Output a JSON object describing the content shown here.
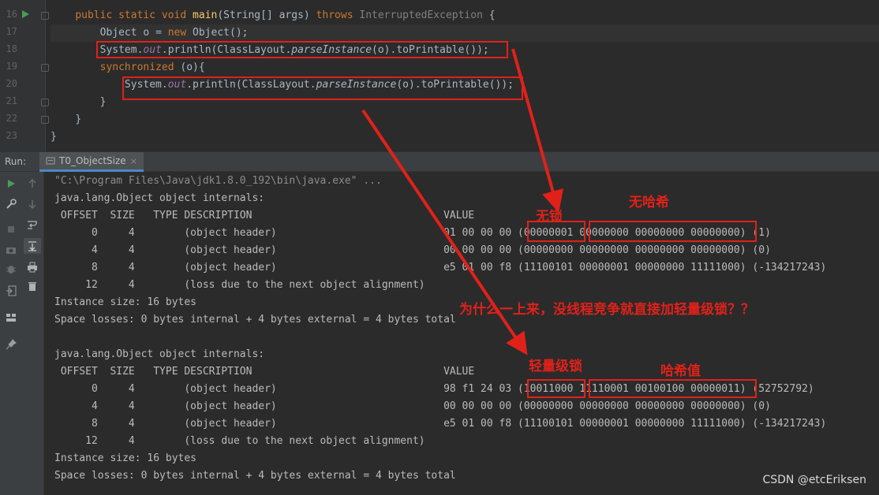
{
  "editor": {
    "line_numbers": [
      "16",
      "17",
      "18",
      "19",
      "20",
      "21",
      "22",
      "23"
    ],
    "lines": [
      {
        "indent": "    ",
        "parts": [
          [
            "kw",
            "public static void "
          ],
          [
            "fn",
            "main"
          ],
          [
            "id",
            "(String[] args) "
          ],
          [
            "kw",
            "throws "
          ],
          [
            "gray",
            "InterruptedException"
          ],
          [
            "id",
            " {"
          ]
        ]
      },
      {
        "indent": "        ",
        "parts": [
          [
            "id",
            "Object o = "
          ],
          [
            "kw",
            "new "
          ],
          [
            "id",
            "Object();"
          ]
        ]
      },
      {
        "indent": "        ",
        "parts": [
          [
            "id",
            "System."
          ],
          [
            "fld",
            "out"
          ],
          [
            "id",
            ".println(ClassLayout."
          ],
          [
            "mth",
            "parseInstance"
          ],
          [
            "id",
            "(o).toPrintable());"
          ]
        ]
      },
      {
        "indent": "        ",
        "parts": [
          [
            "kw",
            "synchronized "
          ],
          [
            "id",
            "(o){"
          ]
        ]
      },
      {
        "indent": "            ",
        "parts": [
          [
            "id",
            "System."
          ],
          [
            "fld",
            "out"
          ],
          [
            "id",
            ".println(ClassLayout."
          ],
          [
            "mth",
            "parseInstance"
          ],
          [
            "id",
            "(o).toPrintable());"
          ]
        ]
      },
      {
        "indent": "        ",
        "parts": [
          [
            "id",
            "}"
          ]
        ]
      },
      {
        "indent": "    ",
        "parts": [
          [
            "id",
            "}"
          ]
        ]
      },
      {
        "indent": "",
        "parts": [
          [
            "id",
            "}"
          ]
        ]
      }
    ]
  },
  "run": {
    "label": "Run:",
    "tab": "T0_ObjectSize",
    "close": "×"
  },
  "console": {
    "command": "\"C:\\Program Files\\Java\\jdk1.8.0_192\\bin\\java.exe\" ...",
    "lines": [
      "java.lang.Object object internals:",
      " OFFSET  SIZE   TYPE DESCRIPTION                               VALUE",
      "      0     4        (object header)                           01 00 00 00 (00000001 00000000 00000000 00000000) (1)",
      "      4     4        (object header)                           00 00 00 00 (00000000 00000000 00000000 00000000) (0)",
      "      8     4        (object header)                           e5 01 00 f8 (11100101 00000001 00000000 11111000) (-134217243)",
      "     12     4        (loss due to the next object alignment)",
      "Instance size: 16 bytes",
      "Space losses: 0 bytes internal + 4 bytes external = 4 bytes total",
      "",
      "java.lang.Object object internals:",
      " OFFSET  SIZE   TYPE DESCRIPTION                               VALUE",
      "      0     4        (object header)                           98 f1 24 03 (10011000 11110001 00100100 00000011) (52752792)",
      "      4     4        (object header)                           00 00 00 00 (00000000 00000000 00000000 00000000) (0)",
      "      8     4        (object header)                           e5 01 00 f8 (11100101 00000001 00000000 11111000) (-134217243)",
      "     12     4        (loss due to the next object alignment)",
      "Instance size: 16 bytes",
      "Space losses: 0 bytes internal + 4 bytes external = 4 bytes total"
    ]
  },
  "annotations": {
    "no_lock": "无锁",
    "no_hash": "无哈希",
    "question": "为什么一上来，没线程竞争就直接加轻量级锁？？",
    "light_lock": "轻量级锁",
    "hash_value": "哈希值"
  },
  "watermark": "CSDN @etcEriksen",
  "colors": {
    "annotation": "#e0211a",
    "keyword": "#cc7832",
    "method": "#ffc66d",
    "field": "#9876aa"
  }
}
